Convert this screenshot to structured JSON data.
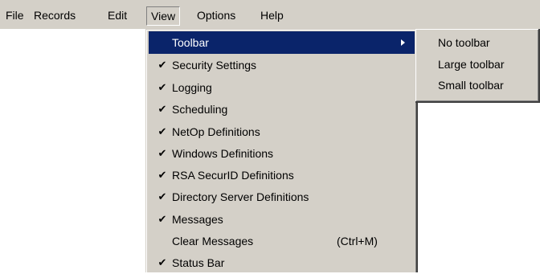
{
  "menubar": {
    "items": [
      {
        "label": "File"
      },
      {
        "label": "Records"
      },
      {
        "label": "Edit"
      },
      {
        "label": "View"
      },
      {
        "label": "Options"
      },
      {
        "label": "Help"
      }
    ]
  },
  "view_menu": {
    "items": [
      {
        "label": "Toolbar",
        "checked": false,
        "highlighted": true,
        "has_submenu": true,
        "check": "",
        "shortcut": ""
      },
      {
        "label": "Security Settings",
        "checked": true,
        "check": "✔",
        "shortcut": ""
      },
      {
        "label": "Logging",
        "checked": true,
        "check": "✔",
        "shortcut": ""
      },
      {
        "label": "Scheduling",
        "checked": true,
        "check": "✔",
        "shortcut": ""
      },
      {
        "label": "NetOp Definitions",
        "checked": true,
        "check": "✔",
        "shortcut": ""
      },
      {
        "label": "Windows Definitions",
        "checked": true,
        "check": "✔",
        "shortcut": ""
      },
      {
        "label": "RSA SecurID Definitions",
        "checked": true,
        "check": "✔",
        "shortcut": ""
      },
      {
        "label": "Directory Server Definitions",
        "checked": true,
        "check": "✔",
        "shortcut": ""
      },
      {
        "label": "Messages",
        "checked": true,
        "check": "✔",
        "shortcut": ""
      },
      {
        "label": "Clear Messages",
        "checked": false,
        "check": "",
        "shortcut": "(Ctrl+M)"
      },
      {
        "label": "Status Bar",
        "checked": true,
        "check": "✔",
        "shortcut": ""
      }
    ]
  },
  "toolbar_submenu": {
    "items": [
      {
        "label": "No toolbar"
      },
      {
        "label": "Large toolbar"
      },
      {
        "label": "Small toolbar"
      }
    ]
  },
  "colors": {
    "menu_background": "#d4d0c8",
    "highlight_background": "#0a246a",
    "highlight_text": "#ffffff"
  },
  "icons": {
    "check": "checkmark-icon",
    "submenu_arrow": "chevron-right-icon"
  }
}
